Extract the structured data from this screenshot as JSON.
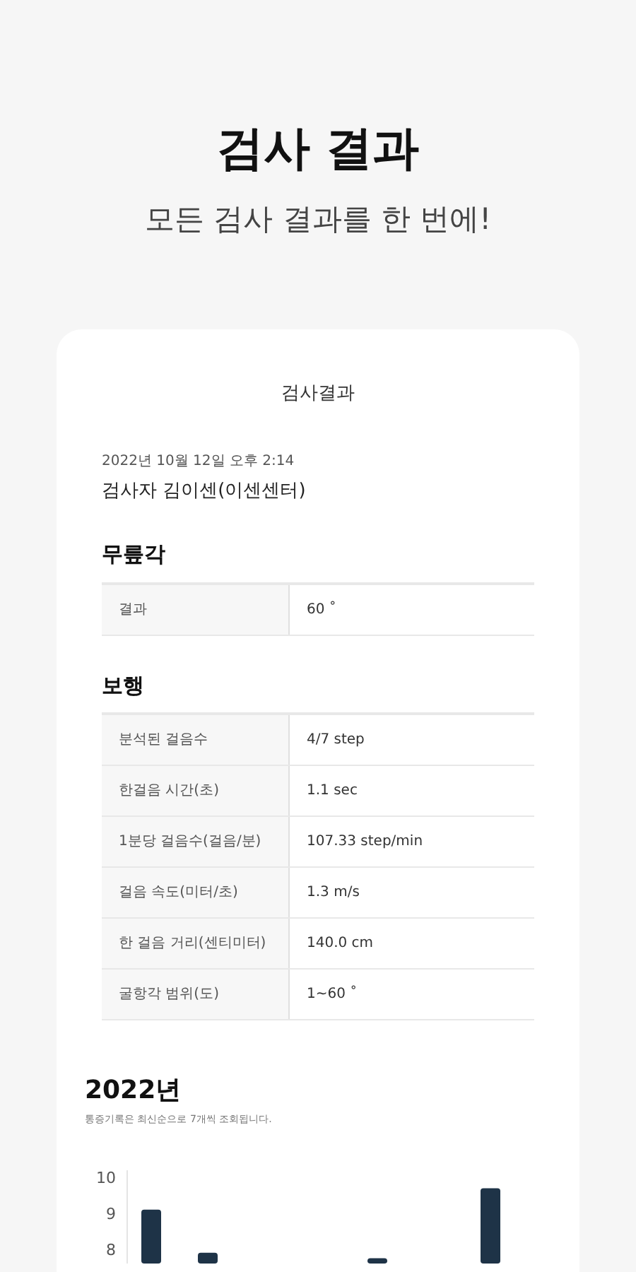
{
  "header": {
    "title": "검사 결과",
    "subtitle": "모든 검사 결과를 한 번에!"
  },
  "card": {
    "title": "검사결과",
    "date": "2022년 10월 12일 오후 2:14",
    "examiner": "검사자 김이센(이센센터)",
    "sections": [
      {
        "title": "무릎각",
        "rows": [
          {
            "label": "결과",
            "value": "60 ˚"
          }
        ]
      },
      {
        "title": "보행",
        "rows": [
          {
            "label": "분석된 걸음수",
            "value": "4/7 step"
          },
          {
            "label": "한걸음 시간(초)",
            "value": "1.1 sec"
          },
          {
            "label": "1분당 걸음수(걸음/분)",
            "value": "107.33 step/min"
          },
          {
            "label": "걸음 속도(미터/초)",
            "value": "1.3 m/s"
          },
          {
            "label": "한 걸음 거리(센티미터)",
            "value": "140.0 cm"
          },
          {
            "label": "굴항각 범위(도)",
            "value": "1~60 ˚"
          }
        ]
      }
    ],
    "history": {
      "year": "2022년",
      "note": "통증기록은 최신순으로 7개씩 조회됩니다.",
      "axis_labels": [
        "10",
        "9",
        "8"
      ]
    }
  }
}
